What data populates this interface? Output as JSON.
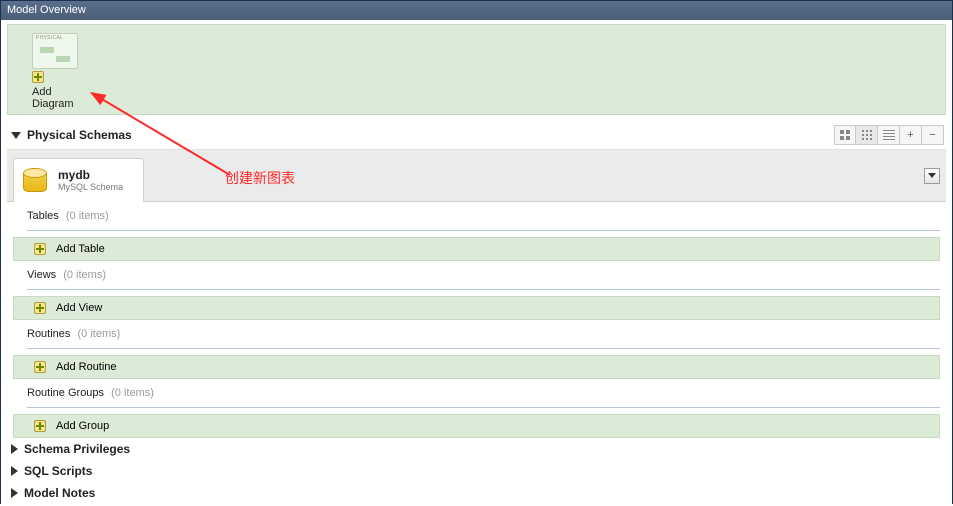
{
  "window": {
    "title": "Model Overview"
  },
  "diagram": {
    "add_label": "Add Diagram"
  },
  "physical": {
    "title": "Physical Schemas",
    "toolbar": {
      "plus": "+",
      "minus": "−"
    }
  },
  "schema": {
    "name": "mydb",
    "subtitle": "MySQL Schema"
  },
  "categories": {
    "tables": {
      "label": "Tables",
      "count": "(0 items)",
      "add": "Add Table"
    },
    "views": {
      "label": "Views",
      "count": "(0 items)",
      "add": "Add View"
    },
    "routines": {
      "label": "Routines",
      "count": "(0 items)",
      "add": "Add Routine"
    },
    "routinegroups": {
      "label": "Routine Groups",
      "count": "(0 items)",
      "add": "Add Group"
    }
  },
  "sections": {
    "privileges": "Schema Privileges",
    "sql": "SQL Scripts",
    "notes": "Model Notes"
  },
  "annotation": {
    "text": "创建新图表"
  }
}
